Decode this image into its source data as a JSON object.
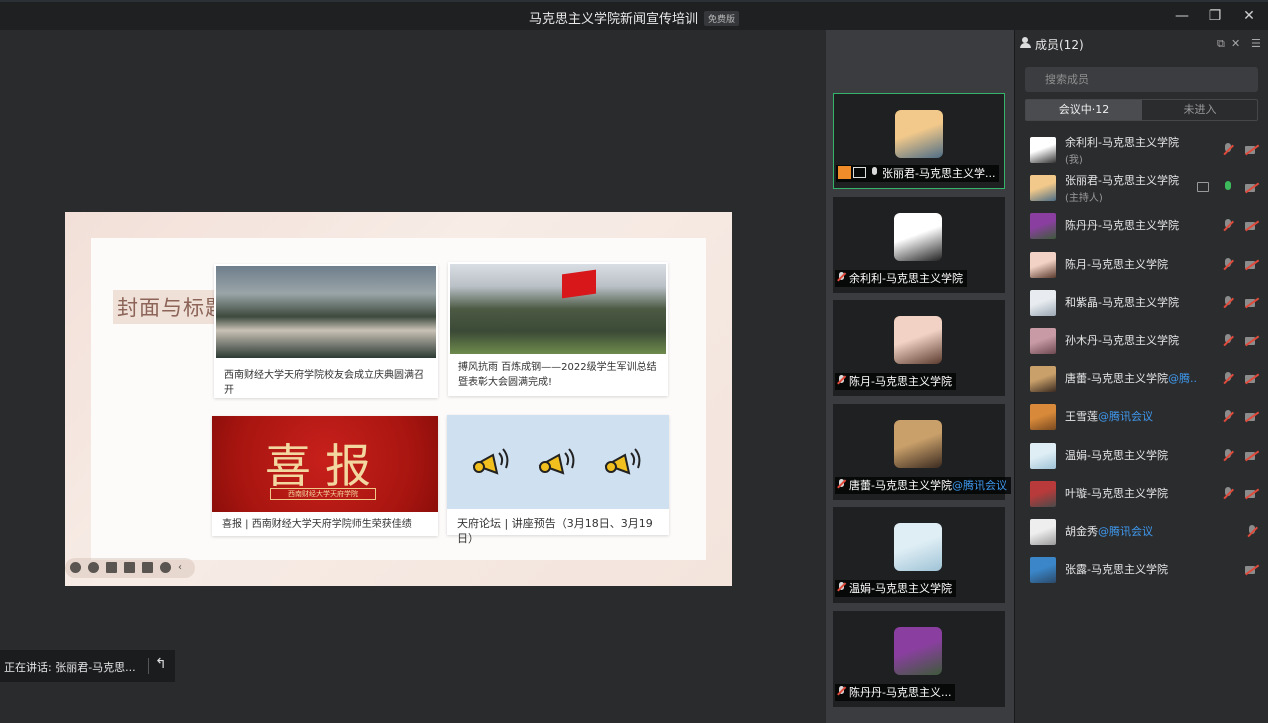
{
  "window": {
    "title": "马克思主义学院新闻宣传培训",
    "badge": "免费版",
    "minimize": "—",
    "restore": "❐",
    "close": "✕"
  },
  "slide": {
    "heading": "封面与标题",
    "news": [
      {
        "caption": "西南财经大学天府学院校友会成立庆典圆满召开"
      },
      {
        "caption": "搏风抗雨 百炼成钢——2022级学生军训总结暨表彰大会圆满完成!"
      },
      {
        "caption": "喜报 | 西南财经大学天府学院师生荣获佳绩",
        "banner": "喜报",
        "banner_sub": "西南财经大学天府学院"
      },
      {
        "caption": "天府论坛 | 讲座预告（3月18日、3月19日）"
      }
    ]
  },
  "speaking": {
    "text": "正在讲话: 张丽君-马克思...",
    "back_icon": "↰"
  },
  "video_tiles": [
    {
      "label": "张丽君-马克思主义学...",
      "active": true,
      "host": true,
      "sharing": true,
      "muted": false,
      "avatar_colors": [
        "#f2c98a",
        "#4d6d86"
      ]
    },
    {
      "label": "余利利-马克思主义学院",
      "active": false,
      "muted": true,
      "avatar_colors": [
        "#ffffff",
        "#222222"
      ]
    },
    {
      "label": "陈月-马克思主义学院",
      "active": false,
      "muted": true,
      "avatar_colors": [
        "#f1d2c4",
        "#5b3b2e"
      ]
    },
    {
      "label": "唐蕾-马克思主义学院",
      "label_org": "@腾讯会议",
      "active": false,
      "muted": true,
      "avatar_colors": [
        "#c9a06a",
        "#3a2a20"
      ]
    },
    {
      "label": "温娟-马克思主义学院",
      "active": false,
      "muted": true,
      "avatar_colors": [
        "#dfeef5",
        "#9fc3d6"
      ]
    },
    {
      "label": "陈丹丹-马克思主义...",
      "active": false,
      "muted": true,
      "avatar_colors": [
        "#8a3fa0",
        "#3e5a3a"
      ]
    }
  ],
  "panel": {
    "title": "成员(12)",
    "popout_icon": "⧉",
    "close_icon": "✕",
    "menu_icon": "☰",
    "search_placeholder": "搜索成员",
    "tab_in_meeting": "会议中·12",
    "tab_not_joined": "未进入",
    "members": [
      {
        "name": "余利利-马克思主义学院",
        "role": "(我)",
        "mic": "muted",
        "cam": "off",
        "avatar_colors": [
          "#ffffff",
          "#333333"
        ]
      },
      {
        "name": "张丽君-马克思主义学院",
        "role": "(主持人)",
        "mic": "live",
        "cam": "off",
        "screen": true,
        "avatar_colors": [
          "#f2c98a",
          "#4d6d86"
        ]
      },
      {
        "name": "陈丹丹-马克思主义学院",
        "mic": "muted",
        "cam": "off",
        "avatar_colors": [
          "#8a3fa0",
          "#3e5a3a"
        ]
      },
      {
        "name": "陈月-马克思主义学院",
        "mic": "muted",
        "cam": "off",
        "avatar_colors": [
          "#f1d2c4",
          "#5b3b2e"
        ]
      },
      {
        "name": "和紫晶-马克思主义学院",
        "mic": "muted",
        "cam": "off",
        "avatar_colors": [
          "#e8ecf0",
          "#9aa7b4"
        ]
      },
      {
        "name": "孙木丹-马克思主义学院",
        "mic": "muted",
        "cam": "off",
        "avatar_colors": [
          "#c79aa6",
          "#6e4a52"
        ]
      },
      {
        "name": "唐蕾-马克思主义学院",
        "org": "@腾...",
        "mic": "muted",
        "cam": "off",
        "avatar_colors": [
          "#c9a06a",
          "#3a2a20"
        ]
      },
      {
        "name": "王雪莲",
        "org": "@腾讯会议",
        "mic": "muted",
        "cam": "off",
        "avatar_colors": [
          "#d88a3a",
          "#7a4a20"
        ]
      },
      {
        "name": "温娟-马克思主义学院",
        "mic": "muted",
        "cam": "off",
        "avatar_colors": [
          "#dfeef5",
          "#9fc3d6"
        ]
      },
      {
        "name": "叶璇-马克思主义学院",
        "mic": "muted",
        "cam": "off",
        "avatar_colors": [
          "#b83a3a",
          "#4a4a4a"
        ]
      },
      {
        "name": "胡金秀",
        "org": "@腾讯会议",
        "mic": "muted",
        "cam": "none",
        "avatar_colors": [
          "#eeeeee",
          "#9a9a9a"
        ]
      },
      {
        "name": "张露-马克思主义学院",
        "mic": "none",
        "cam": "off",
        "avatar_colors": [
          "#3a86c8",
          "#2b4a6a"
        ]
      }
    ]
  }
}
